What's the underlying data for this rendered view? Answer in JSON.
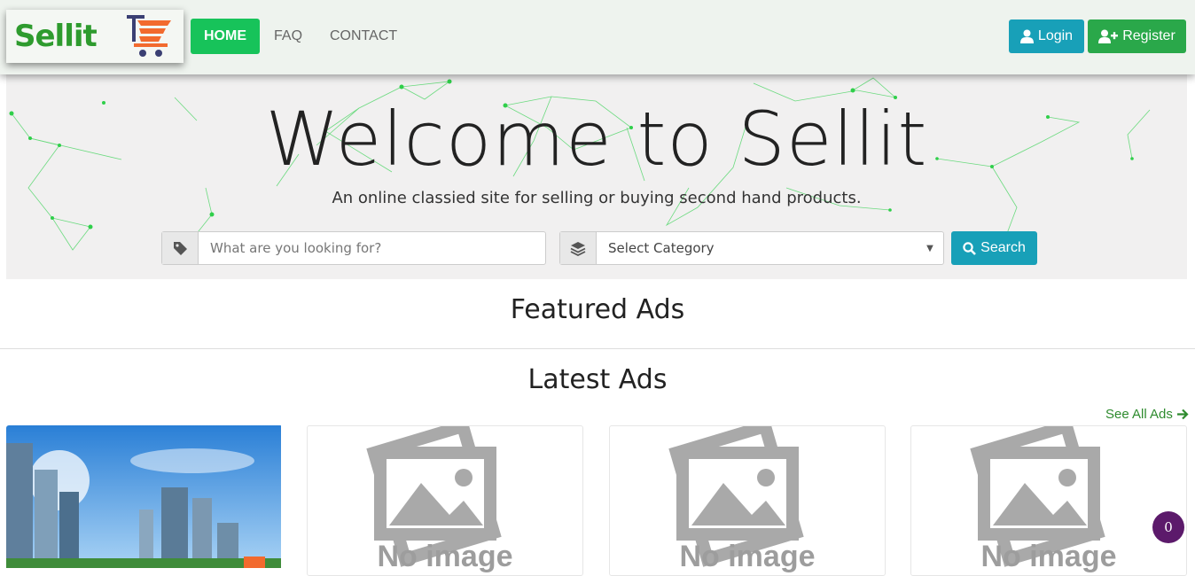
{
  "brand": {
    "logo_text": "Sellit",
    "accent": "#17c35a"
  },
  "nav": {
    "items": [
      {
        "label": "HOME",
        "active": true
      },
      {
        "label": "FAQ",
        "active": false
      },
      {
        "label": "CONTACT",
        "active": false
      }
    ],
    "login_label": "Login",
    "register_label": "Register"
  },
  "hero": {
    "title": "Welcome to Sellit",
    "subtitle": "An online classied site for selling or buying second hand products.",
    "search_placeholder": "What are you looking for?",
    "category_selected": "Select Category",
    "search_button": "Search"
  },
  "sections": {
    "featured_title": "Featured Ads",
    "latest_title": "Latest Ads",
    "see_all_label": "See All Ads"
  },
  "latest_ads": [
    {
      "image": "city-buildings-photo"
    },
    {
      "image": "no-image-placeholder",
      "placeholder_text": "No image"
    },
    {
      "image": "no-image-placeholder",
      "placeholder_text": "No image"
    },
    {
      "image": "no-image-placeholder",
      "placeholder_text": "No image"
    }
  ],
  "chat": {
    "count": "0"
  },
  "icons": {
    "login": "user-icon",
    "register": "user-plus-icon",
    "search_tag": "tag-icon",
    "category": "layers-icon",
    "search_button": "search-icon",
    "see_all": "arrow-right-icon"
  }
}
